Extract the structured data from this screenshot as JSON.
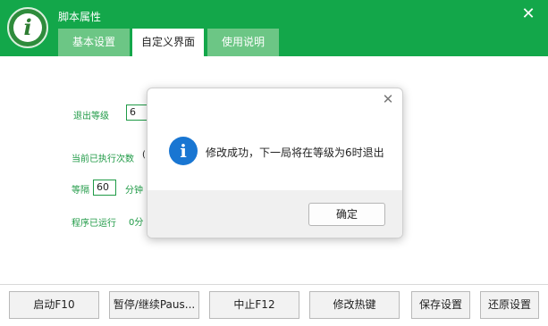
{
  "window": {
    "title": "脚本属性",
    "close_glyph": "✕",
    "logo_glyph": "i"
  },
  "tabs": [
    {
      "label": "基本设置",
      "active": false
    },
    {
      "label": "自定义界面",
      "active": true
    },
    {
      "label": "使用说明",
      "active": false
    }
  ],
  "form": {
    "exit_level_label": "退出等级",
    "exit_level_value": "6",
    "exec_count_label": "当前已执行次数",
    "exec_count_value": "(",
    "interval_label": "等隔",
    "interval_value": "60",
    "interval_unit": "分钟",
    "runtime_label": "程序已运行",
    "runtime_value": "0分"
  },
  "buttons": {
    "start": "启动F10",
    "pause": "暂停/继续Paus...",
    "stop": "中止F12",
    "hotkey": "修改热键",
    "save": "保存设置",
    "restore": "还原设置"
  },
  "dialog": {
    "icon_glyph": "i",
    "message": "修改成功，下一局将在等级为6时退出",
    "ok_label": "确定",
    "close_glyph": "✕"
  },
  "colors": {
    "brand_green": "#13a74a",
    "label_green": "#1f9a46",
    "info_blue": "#1976d2"
  }
}
